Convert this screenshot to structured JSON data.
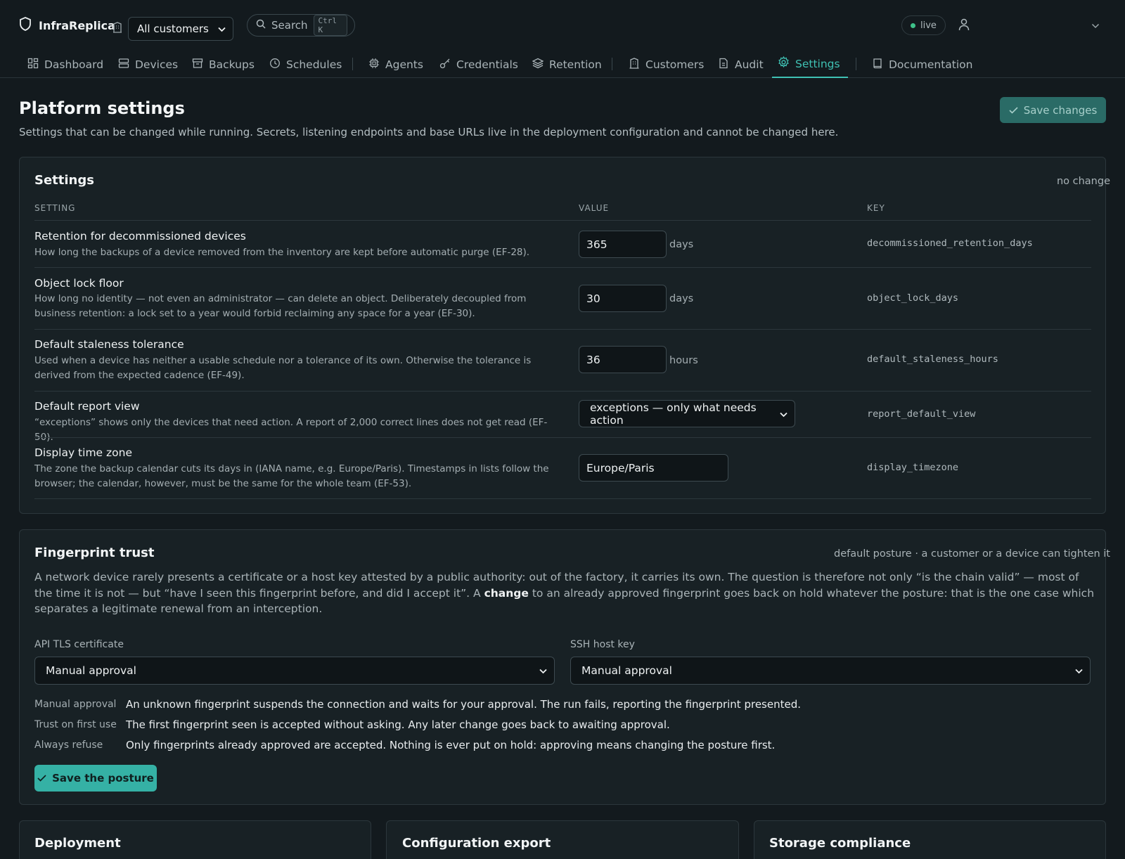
{
  "app": {
    "name": "InfraReplica"
  },
  "header": {
    "customer_select": "All customers",
    "search": {
      "label": "Search",
      "shortcut": "Ctrl K"
    },
    "status": "live"
  },
  "nav": [
    {
      "label": "Dashboard",
      "icon": "dashboard-icon"
    },
    {
      "label": "Devices",
      "icon": "server-icon"
    },
    {
      "label": "Backups",
      "icon": "archive-icon"
    },
    {
      "label": "Schedules",
      "icon": "clock-icon"
    },
    {
      "label": "Agents",
      "icon": "cpu-icon"
    },
    {
      "label": "Credentials",
      "icon": "key-icon"
    },
    {
      "label": "Retention",
      "icon": "layers-icon"
    },
    {
      "label": "Customers",
      "icon": "building-icon"
    },
    {
      "label": "Audit",
      "icon": "document-icon"
    },
    {
      "label": "Settings",
      "icon": "gear-icon",
      "active": true
    },
    {
      "label": "Documentation",
      "icon": "book-icon"
    }
  ],
  "page": {
    "title": "Platform settings",
    "subtitle": "Settings that can be changed while running. Secrets, listening endpoints and base URLs live in the deployment configuration and cannot be changed here.",
    "save_label": "Save changes"
  },
  "settings": {
    "title": "Settings",
    "status": "no change",
    "columns": {
      "setting": "SETTING",
      "value": "VALUE",
      "key": "KEY"
    },
    "rows": [
      {
        "name": "Retention for decommissioned devices",
        "desc": "How long the backups of a device removed from the inventory are kept before automatic purge (EF-28).",
        "value": "365",
        "unit": "days",
        "key": "decommissioned_retention_days"
      },
      {
        "name": "Object lock floor",
        "desc": "How long no identity — not even an administrator — can delete an object. Deliberately decoupled from business retention: a lock set to a year would forbid reclaiming any space for a year (EF-30).",
        "value": "30",
        "unit": "days",
        "key": "object_lock_days"
      },
      {
        "name": "Default staleness tolerance",
        "desc": "Used when a device has neither a usable schedule nor a tolerance of its own. Otherwise the tolerance is derived from the expected cadence (EF-49).",
        "value": "36",
        "unit": "hours",
        "key": "default_staleness_hours"
      },
      {
        "name": "Default report view",
        "desc": "“exceptions” shows only the devices that need action. A report of 2,000 correct lines does not get read (EF-50).",
        "value": "exceptions — only what needs action",
        "unit": "",
        "key": "report_default_view"
      },
      {
        "name": "Display time zone",
        "desc": "The zone the backup calendar cuts its days in (IANA name, e.g. Europe/Paris). Timestamps in lists follow the browser; the calendar, however, must be the same for the whole team (EF-53).",
        "value": "Europe/Paris",
        "unit": "",
        "key": "display_timezone"
      }
    ]
  },
  "fingerprint": {
    "title": "Fingerprint trust",
    "note": "default posture · a customer or a device can tighten it",
    "text_before": "A network device rarely presents a certificate or a host key attested by a public authority: out of the factory, it carries its own. The question is therefore not only “is the chain valid” — most of the time it is not — but “have I seen this fingerprint before, and did I accept it”. A ",
    "text_bold": "change",
    "text_after": " to an already approved fingerprint goes back on hold whatever the posture: that is the one case which separates a legitimate renewal from an interception.",
    "api_label": "API TLS certificate",
    "api_value": "Manual approval",
    "ssh_label": "SSH host key",
    "ssh_value": "Manual approval",
    "legend": [
      {
        "term": "Manual approval",
        "desc": "An unknown fingerprint suspends the connection and waits for your approval. The run fails, reporting the fingerprint presented."
      },
      {
        "term": "Trust on first use",
        "desc": "The first fingerprint seen is accepted without asking. Any later change goes back to awaiting approval."
      },
      {
        "term": "Always refuse",
        "desc": "Only fingerprints already approved are accepted. Nothing is ever put on hold: approving means changing the posture first."
      }
    ],
    "save_label": "Save the posture"
  },
  "bottom_cards": [
    "Deployment",
    "Configuration export",
    "Storage compliance"
  ],
  "colors": {
    "accent": "#3fc1b3",
    "bg": "#131a1e",
    "card": "#182125",
    "live": "#3ec28a"
  }
}
